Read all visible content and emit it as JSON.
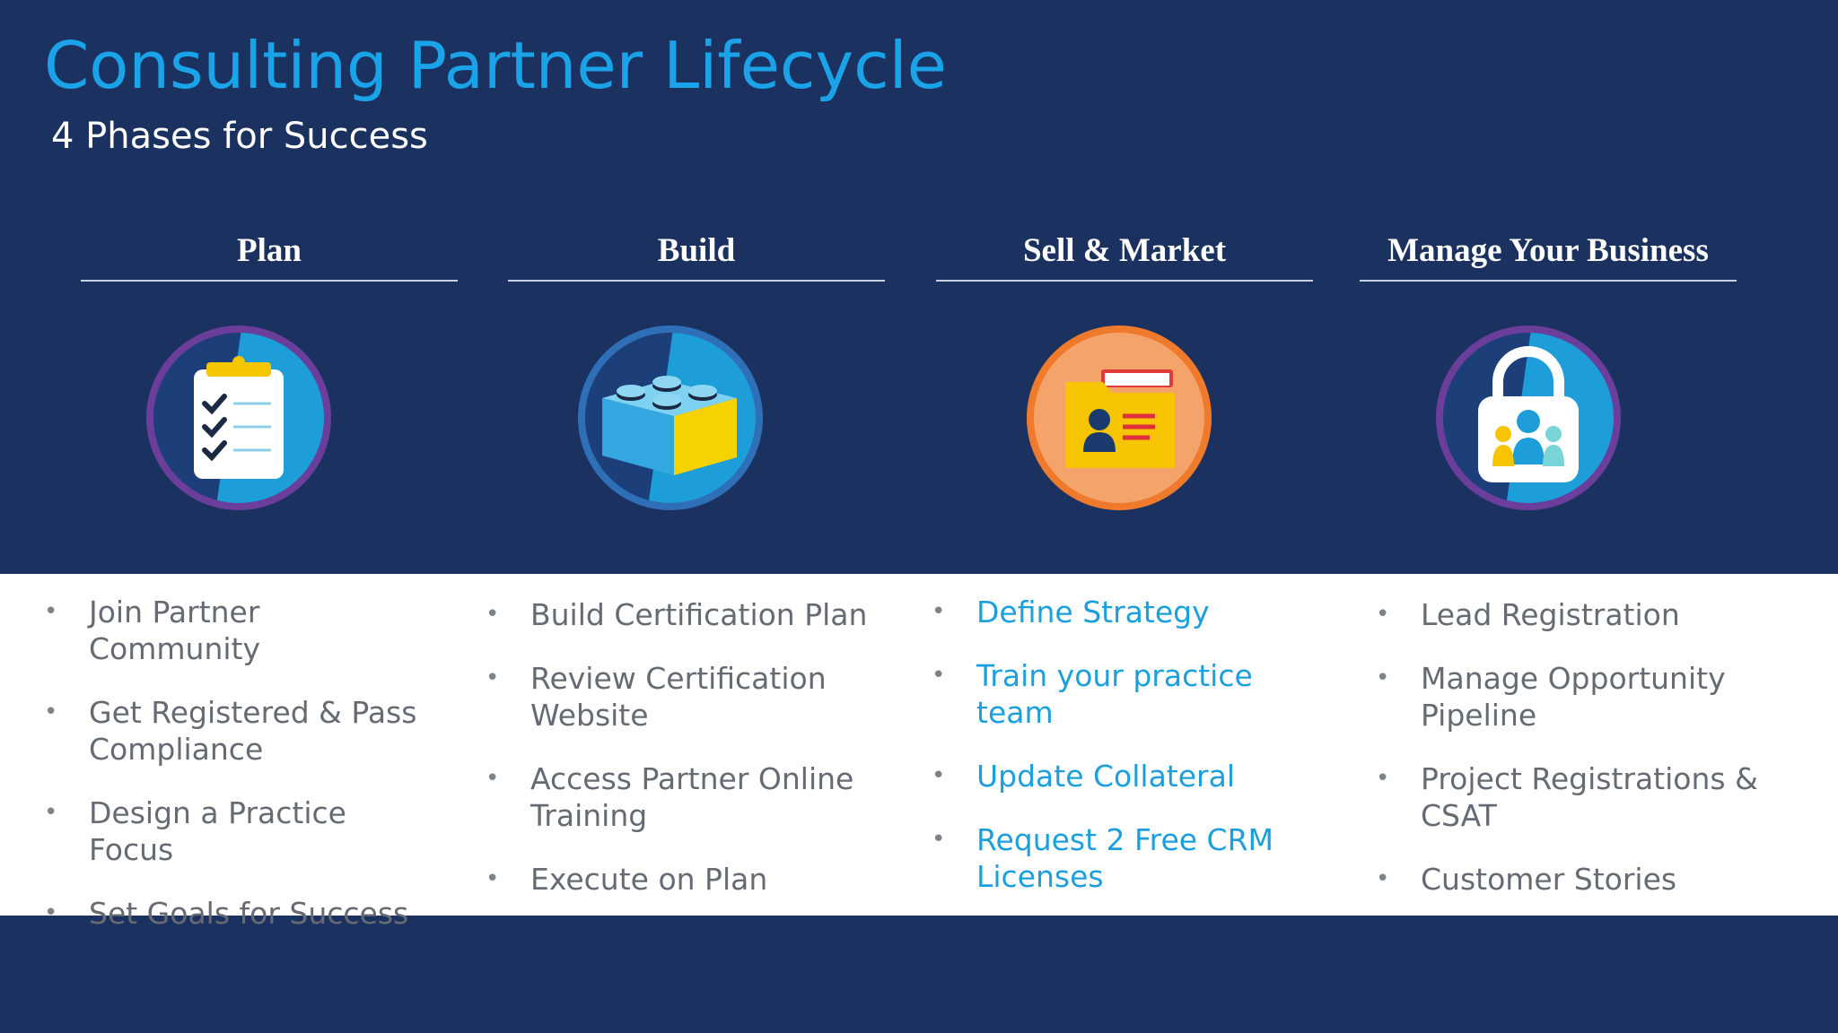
{
  "title": "Consulting Partner Lifecycle",
  "subtitle": "4 Phases for Success",
  "colors": {
    "background": "#1b3260",
    "title": "#1aa3e8",
    "highlight_text": "#1b9fdd",
    "body_text": "#666b73"
  },
  "phases": [
    {
      "name": "Plan",
      "icon": "clipboard-checklist-icon",
      "bullets": [
        "Join Partner Community",
        "Get Registered & Pass Compliance",
        "Design a Practice Focus",
        "Set Goals for Success"
      ]
    },
    {
      "name": "Build",
      "icon": "building-block-icon",
      "bullets": [
        "Build Certification Plan",
        "Review Certification Website",
        "Access Partner Online Training",
        "Execute on Plan"
      ]
    },
    {
      "name": "Sell & Market",
      "icon": "contact-folder-icon",
      "bullets": [
        "Define Strategy",
        "Train your practice team",
        "Update Collateral",
        "Request 2 Free CRM Licenses"
      ]
    },
    {
      "name": "Manage Your Business",
      "icon": "team-lock-icon",
      "bullets": [
        "Lead Registration",
        "Manage Opportunity Pipeline",
        "Project Registrations & CSAT",
        "Customer Stories"
      ]
    }
  ]
}
